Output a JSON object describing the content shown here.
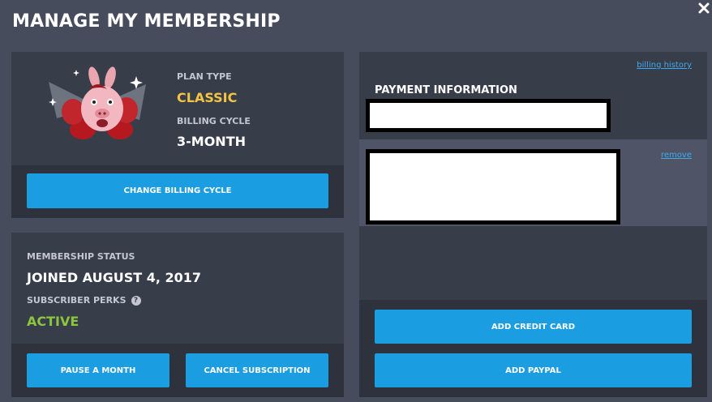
{
  "header": {
    "title": "MANAGE MY MEMBERSHIP"
  },
  "plan": {
    "plan_type_label": "PLAN TYPE",
    "plan_type_value": "CLASSIC",
    "billing_cycle_label": "BILLING CYCLE",
    "billing_cycle_value": "3-MONTH",
    "change_billing_button": "CHANGE BILLING CYCLE"
  },
  "membership": {
    "status_label": "MEMBERSHIP STATUS",
    "joined_text": "JOINED AUGUST 4, 2017",
    "perks_label": "SUBSCRIBER PERKS",
    "perks_status": "ACTIVE",
    "pause_button": "PAUSE A MONTH",
    "cancel_button": "CANCEL SUBSCRIPTION"
  },
  "payment": {
    "billing_history_link": "billing history",
    "title": "PAYMENT INFORMATION",
    "remove_link": "remove",
    "add_credit_card_button": "ADD CREDIT CARD",
    "add_paypal_button": "ADD PAYPAL"
  },
  "colors": {
    "accent_blue": "#1b9de2",
    "plan_yellow": "#f5c443",
    "active_green": "#8cc63f",
    "link_blue": "#3fa9f0"
  },
  "icons": {
    "close": "close-icon",
    "help": "help-icon",
    "mascot": "pig-mascot-illustration"
  }
}
